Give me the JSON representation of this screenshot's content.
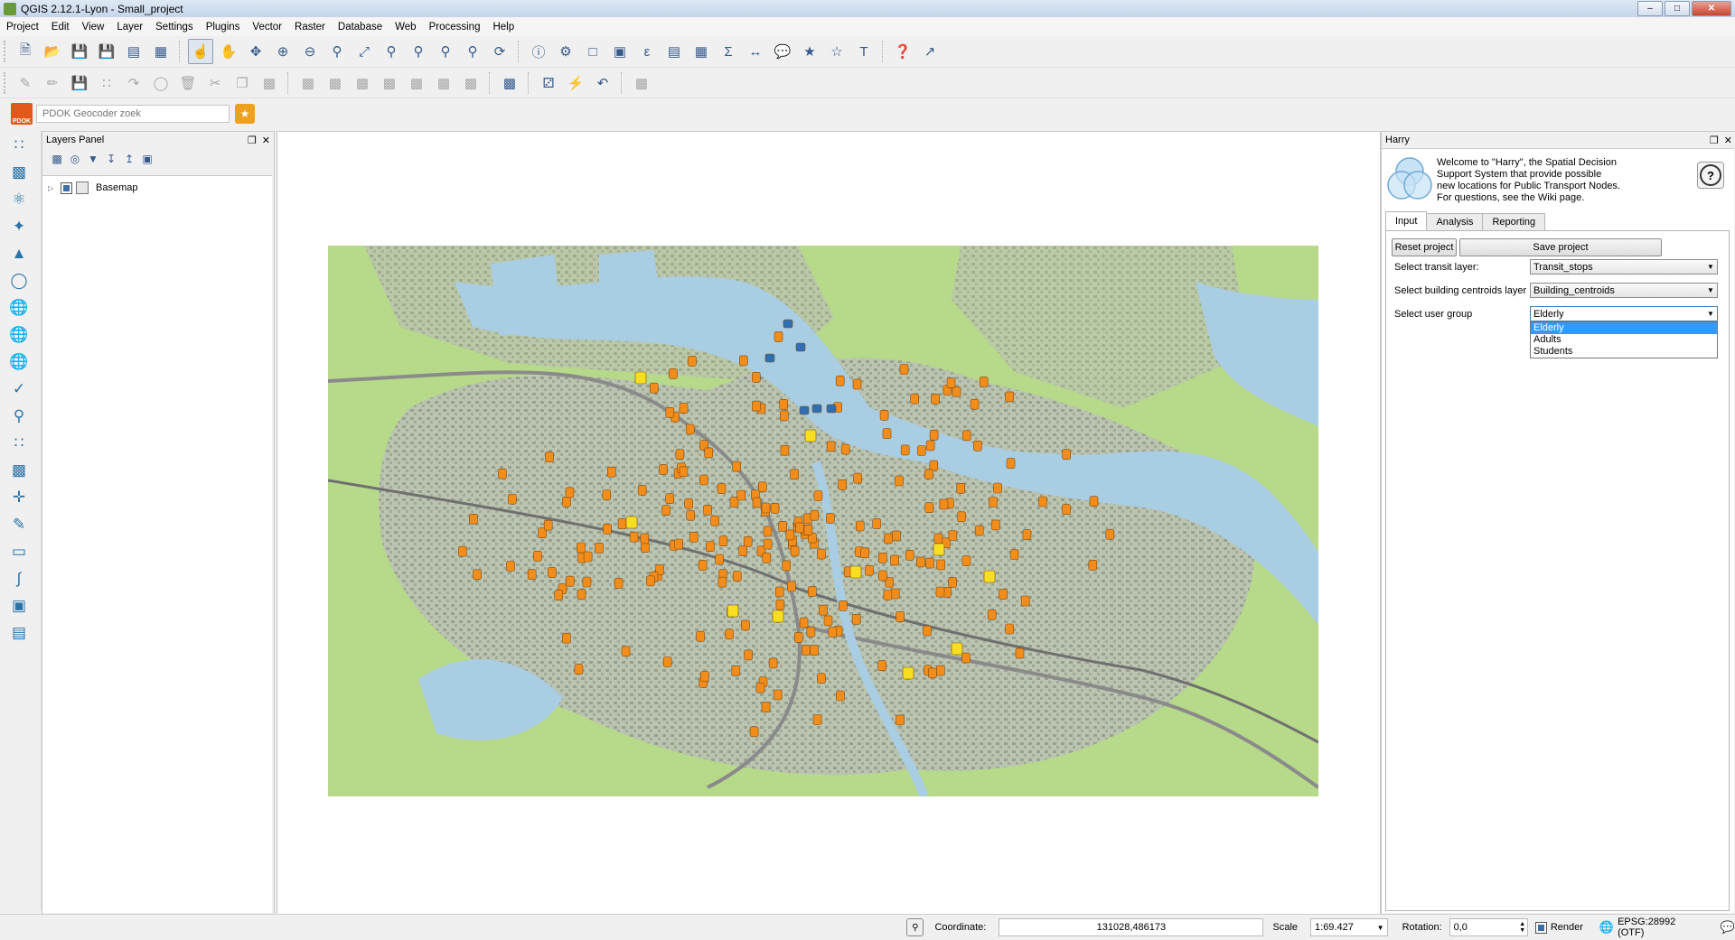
{
  "window": {
    "title": "QGIS 2.12.1-Lyon - Small_project",
    "buttons": [
      "minimize",
      "maximize",
      "close"
    ]
  },
  "menu": [
    "Project",
    "Edit",
    "View",
    "Layer",
    "Settings",
    "Plugins",
    "Vector",
    "Raster",
    "Database",
    "Web",
    "Processing",
    "Help"
  ],
  "pdok": {
    "logo_text": "PDOK",
    "placeholder": "PDOK Geocoder zoek"
  },
  "layers_panel": {
    "title": "Layers Panel",
    "layers": [
      {
        "name": "Basemap",
        "visible": true
      }
    ]
  },
  "harry": {
    "panel_title": "Harry",
    "welcome_lines": [
      "Welcome to \"Harry\", the Spatial Decision",
      "Support System that provide possible",
      "new locations for Public Transport Nodes.",
      "For questions, see the Wiki page."
    ],
    "help_symbol": "?",
    "tabs": [
      "Input",
      "Analysis",
      "Reporting"
    ],
    "active_tab": "Input",
    "reset_label": "Reset project",
    "save_label": "Save project",
    "transit_label": "Select transit layer:",
    "transit_value": "Transit_stops",
    "centroids_label": "Select building centroids layer",
    "centroids_value": "Building_centroids",
    "group_label": "Select user group",
    "group_value": "Elderly",
    "group_options": [
      "Elderly",
      "Adults",
      "Students"
    ]
  },
  "statusbar": {
    "coordinate_label": "Coordinate:",
    "coordinate_value": "131028,486173",
    "scale_label": "Scale",
    "scale_value": "1:69.427",
    "rotation_label": "Rotation:",
    "rotation_value": "0,0",
    "render_label": "Render",
    "render_checked": true,
    "crs_label": "EPSG:28992 (OTF)"
  },
  "colors": {
    "map_land": "#b6d98a",
    "map_water": "#a9cde3",
    "map_urban": "#a7a7a7",
    "tram_stop": "#f28c1a",
    "train_station": "#f6df20",
    "ferry": "#2e6fb4",
    "selection": "#3399ff"
  }
}
